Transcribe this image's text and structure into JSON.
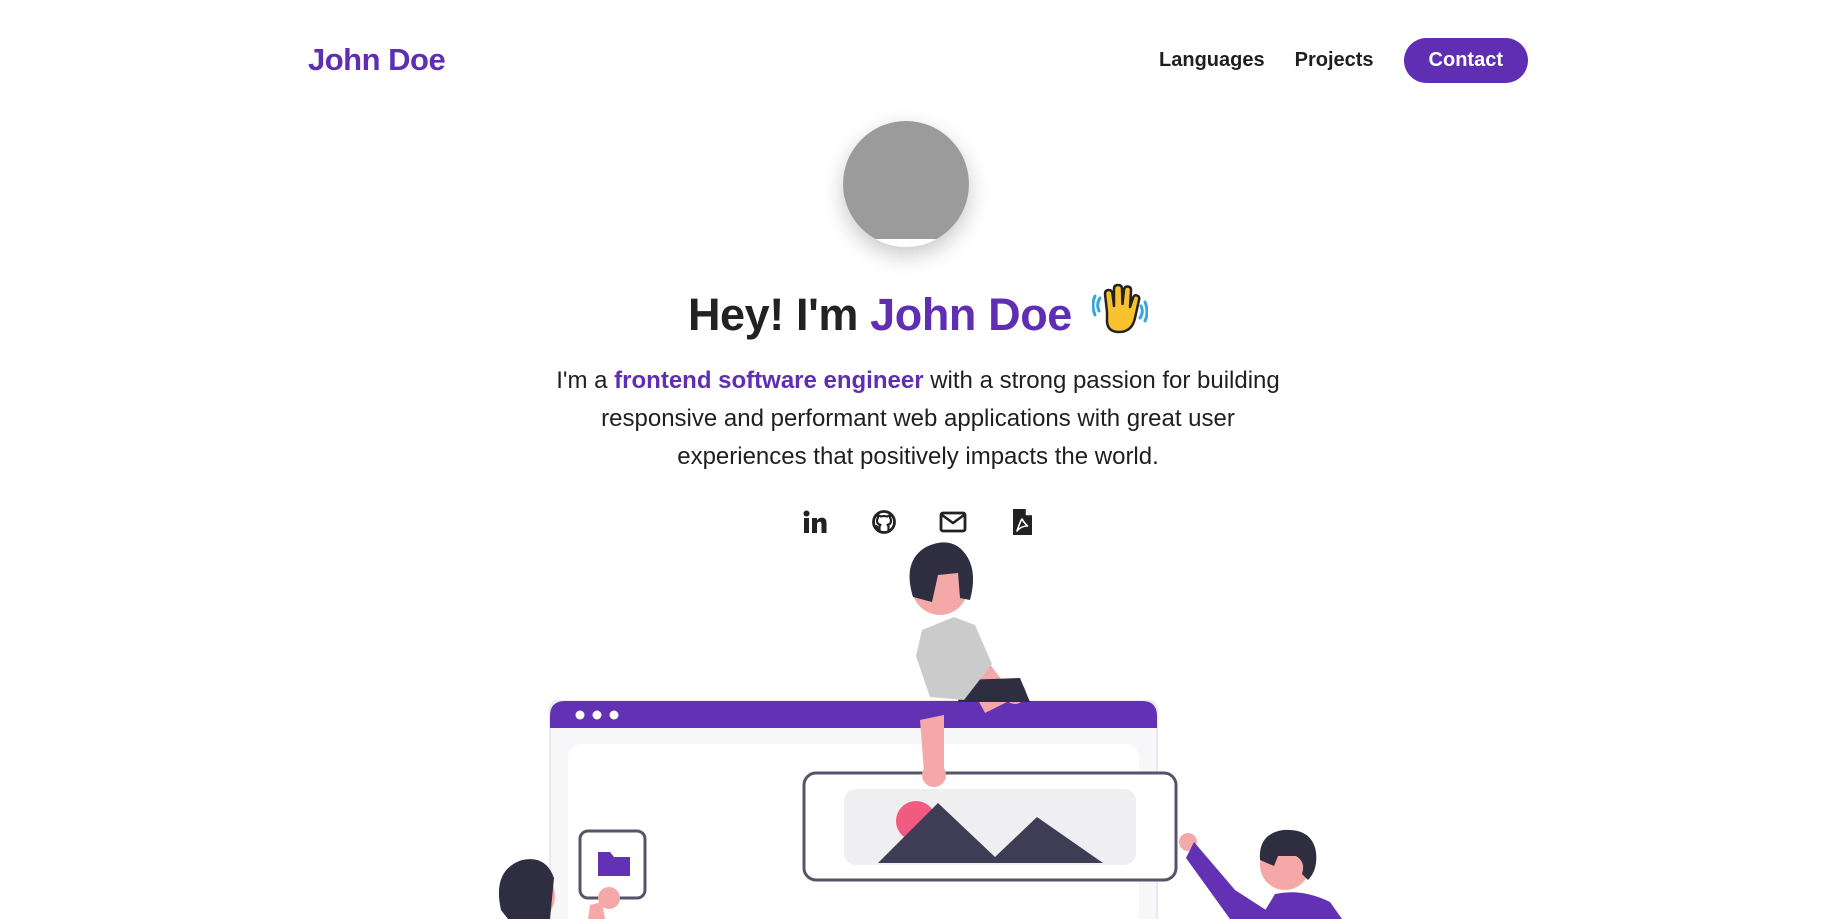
{
  "header": {
    "brand": "John Doe",
    "nav": {
      "languages": "Languages",
      "projects": "Projects",
      "contact": "Contact"
    }
  },
  "hero": {
    "greeting": "Hey! I'm",
    "name": "John Doe",
    "intro_before": "I'm a",
    "intro_highlight": "frontend software engineer",
    "intro_after": "with a strong passion for building responsive and performant web applications with great user experiences that positively impacts the world."
  },
  "social": [
    {
      "icon": "linkedin-icon"
    },
    {
      "icon": "github-icon"
    },
    {
      "icon": "mail-icon"
    },
    {
      "icon": "pdf-icon"
    }
  ],
  "colors": {
    "accent": "#5f2eb3",
    "text": "#222222",
    "avatar_placeholder": "#9b9b9c"
  }
}
